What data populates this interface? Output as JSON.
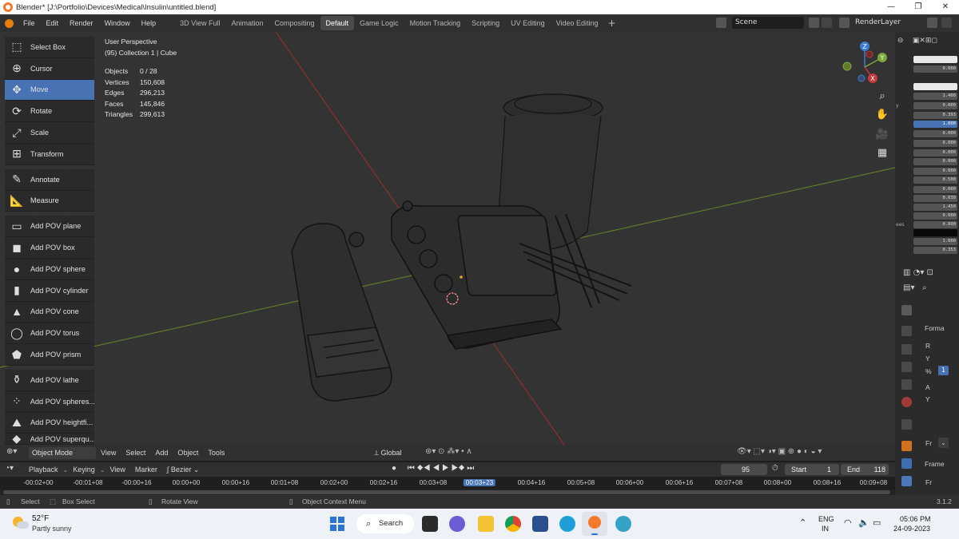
{
  "window": {
    "title": "Blender* [J:\\Portfolio\\Devices\\Medical\\Insulin\\untitled.blend]",
    "controls": [
      "—",
      "❐",
      "✕"
    ]
  },
  "menus": [
    "File",
    "Edit",
    "Render",
    "Window",
    "Help"
  ],
  "workspaces": [
    "3D View Full",
    "Animation",
    "Compositing",
    "Default",
    "Game Logic",
    "Motion Tracking",
    "Scripting",
    "UV Editing",
    "Video Editing"
  ],
  "active_workspace": "Default",
  "scene": {
    "name": "Scene",
    "render_layer": "RenderLayer"
  },
  "toolbar": [
    {
      "label": "Select Box",
      "icon": "select-box-icon",
      "glyph": "⬚"
    },
    {
      "label": "Cursor",
      "icon": "cursor-icon",
      "glyph": "⊕"
    },
    {
      "label": "Move",
      "icon": "move-icon",
      "glyph": "✥"
    },
    {
      "label": "Rotate",
      "icon": "rotate-icon",
      "glyph": "⟳"
    },
    {
      "label": "Scale",
      "icon": "scale-icon",
      "glyph": "⤢"
    },
    {
      "label": "Transform",
      "icon": "transform-icon",
      "glyph": "⊞"
    },
    {
      "label": "Annotate",
      "icon": "annotate-icon",
      "glyph": "✎"
    },
    {
      "label": "Measure",
      "icon": "measure-icon",
      "glyph": "📐"
    },
    {
      "label": "Add POV plane",
      "icon": "pov-plane-icon",
      "glyph": "▭"
    },
    {
      "label": "Add POV box",
      "icon": "pov-box-icon",
      "glyph": "◼"
    },
    {
      "label": "Add POV sphere",
      "icon": "pov-sphere-icon",
      "glyph": "●"
    },
    {
      "label": "Add POV cylinder",
      "icon": "pov-cylinder-icon",
      "glyph": "▮"
    },
    {
      "label": "Add POV cone",
      "icon": "pov-cone-icon",
      "glyph": "▲"
    },
    {
      "label": "Add POV torus",
      "icon": "pov-torus-icon",
      "glyph": "◯"
    },
    {
      "label": "Add POV prism",
      "icon": "pov-prism-icon",
      "glyph": "⬟"
    },
    {
      "label": "Add POV lathe",
      "icon": "pov-lathe-icon",
      "glyph": "⚱"
    },
    {
      "label": "Add POV spheres...",
      "icon": "pov-spheresweep-icon",
      "glyph": "⁘"
    },
    {
      "label": "Add POV heightfi...",
      "icon": "pov-heightfield-icon",
      "glyph": "⛰"
    },
    {
      "label": "Add POV superqu...",
      "icon": "pov-superquadric-icon",
      "glyph": "◆"
    }
  ],
  "active_tool": "Move",
  "viewport": {
    "perspective": "User Perspective",
    "collection": "(95) Collection 1 | Cube",
    "stats": [
      {
        "label": "Objects",
        "value": "0 / 28"
      },
      {
        "label": "Vertices",
        "value": "150,608"
      },
      {
        "label": "Edges",
        "value": "296,213"
      },
      {
        "label": "Faces",
        "value": "145,846"
      },
      {
        "label": "Triangles",
        "value": "299,613"
      }
    ]
  },
  "gizmo": {
    "x": "X",
    "y": "Y",
    "z": "Z"
  },
  "vheader": {
    "mode": "Object Mode",
    "menus": [
      "View",
      "Select",
      "Add",
      "Object",
      "Tools"
    ],
    "orientation": "Global"
  },
  "right_panel": {
    "values": [
      "0.000",
      "1.400",
      "0.000",
      "0.393",
      "1.000",
      "0.000",
      "0.000",
      "0.000",
      "0.000",
      "0.000",
      "0.500",
      "0.000",
      "0.030",
      "1.450",
      "0.000",
      "0.000",
      "1.000",
      "0.353"
    ],
    "side_labels": [
      "y",
      "ees"
    ],
    "format_label": "Forma",
    "frame_label": "Frame",
    "rows": [
      "R",
      "Y",
      "%",
      "A",
      "Y"
    ],
    "percent_value": "1",
    "fr_label": "Fr",
    "fr2_label": "Fr"
  },
  "timeline": {
    "menus": [
      "Playback",
      "Keying",
      "View",
      "Marker"
    ],
    "interpolation": "Bezier",
    "current_frame": "95",
    "start_label": "Start",
    "start": "1",
    "end_label": "End",
    "end": "118",
    "ticks": [
      "-00:02+00",
      "-00:01+08",
      "-00:00+16",
      "00:00+00",
      "00:00+16",
      "00:01+08",
      "00:02+00",
      "00:02+16",
      "00:03+08",
      "00:03+23",
      "00:04+16",
      "00:05+08",
      "00:06+00",
      "00:06+16",
      "00:07+08",
      "00:08+00",
      "00:08+16",
      "00:09+08"
    ],
    "current_tick": "00:03+23"
  },
  "statusbar": {
    "select": "Select",
    "box_select": "Box Select",
    "rotate_view": "Rotate View",
    "context_menu": "Object Context Menu",
    "version": "3.1.2"
  },
  "taskbar": {
    "weather_temp": "52°F",
    "weather_desc": "Partly sunny",
    "search": "Search",
    "lang": "ENG",
    "region": "IN",
    "time": "05:06 PM",
    "date": "24-09-2023"
  },
  "colors": {
    "accent": "#4772b3",
    "viewport_bg": "#333333",
    "panel_bg": "#2b2b2b",
    "x_axis": "#c9383c",
    "y_axis": "#7ca83a",
    "z_axis": "#3a7dd6"
  }
}
